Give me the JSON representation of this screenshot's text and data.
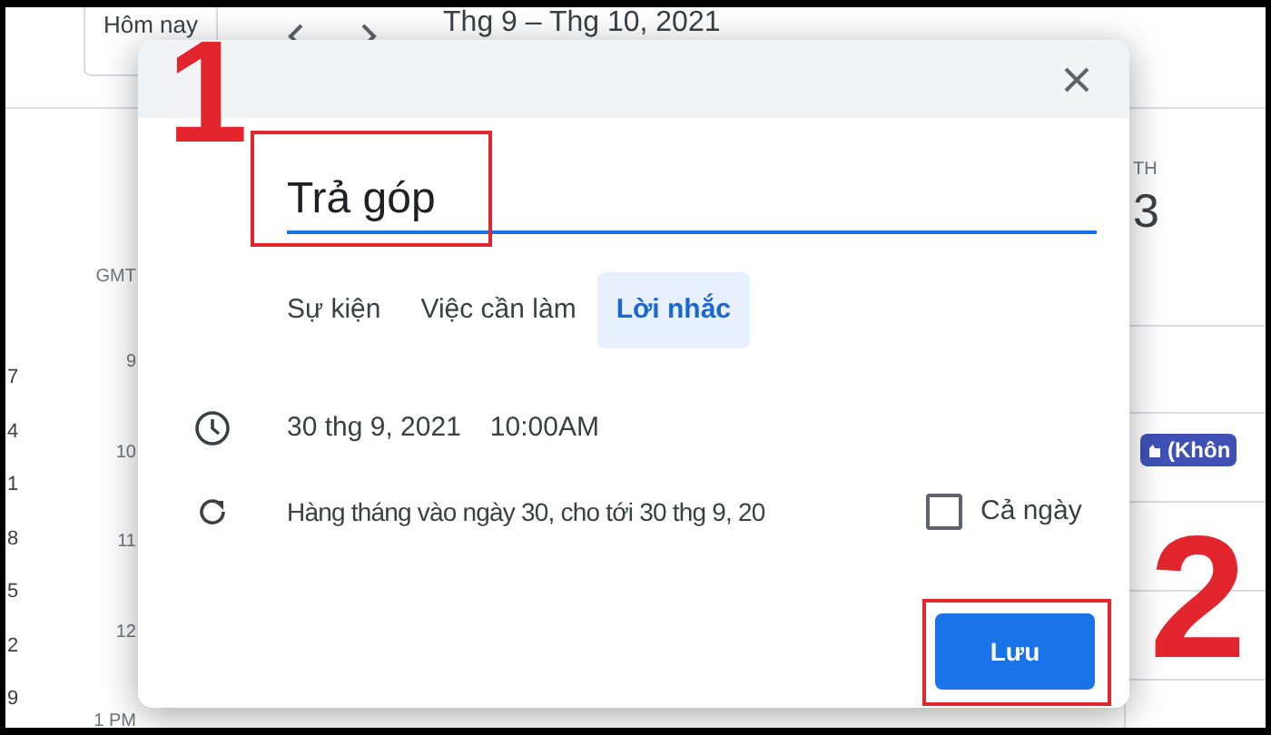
{
  "toolbar": {
    "today_button": "Hôm nay",
    "date_range": "Thg 9 – Thg 10, 2021"
  },
  "mini_calendar": {
    "days": [
      "7",
      "4",
      "1",
      "8",
      "5",
      "2",
      "9"
    ]
  },
  "time_column": {
    "timezone": "GMT",
    "hours": [
      "9",
      "10",
      "11",
      "12",
      "1 PM"
    ]
  },
  "day_column": {
    "weekday": "TH",
    "date": "3"
  },
  "event_chip": {
    "label": "(Khôn"
  },
  "dialog": {
    "title_value": "Trả góp",
    "tabs": [
      {
        "label": "Sự kiện",
        "selected": false
      },
      {
        "label": "Việc cần làm",
        "selected": false
      },
      {
        "label": "Lời nhắc",
        "selected": true
      }
    ],
    "date": "30 thg 9, 2021",
    "time": "10:00AM",
    "recurrence": "Hàng tháng vào ngày 30, cho tới 30 thg 9, 20",
    "all_day": {
      "label": "Cả ngày",
      "checked": false
    },
    "save_button": "Lưu"
  },
  "annotations": [
    {
      "label": "1"
    },
    {
      "label": "2"
    }
  ]
}
